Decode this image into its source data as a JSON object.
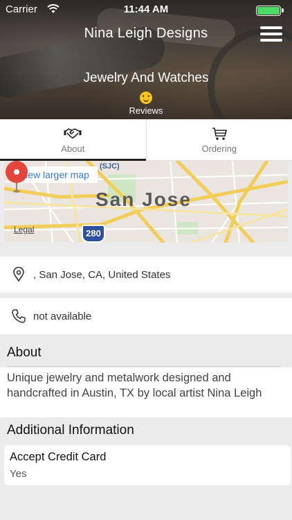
{
  "status_bar": {
    "carrier": "Carrier",
    "time": "11:44 AM",
    "battery_color": "#4cd964"
  },
  "header": {
    "title": "Nina Leigh Designs",
    "category": "Jewelry And Watches",
    "reviews_label": "Reviews",
    "menu_icon": "hamburger-menu-icon"
  },
  "tabs": [
    {
      "label": "About",
      "icon": "handshake-icon",
      "active": true
    },
    {
      "label": "Ordering",
      "icon": "cart-icon",
      "active": false
    }
  ],
  "map": {
    "link_label": "View larger map",
    "city_label": "San Jose",
    "airport_label": "(SJC)",
    "highway_label": "280",
    "legal_label": "Legal"
  },
  "contact": {
    "address": ", San Jose, CA, United States",
    "phone": "not available"
  },
  "about": {
    "heading": "About",
    "text": "Unique jewelry and metalwork designed and handcrafted in Austin, TX by local artist Nina Leigh"
  },
  "additional_info": {
    "heading": "Additional Information",
    "items": [
      {
        "key": "Accept Credit Card",
        "value": "Yes"
      }
    ]
  }
}
